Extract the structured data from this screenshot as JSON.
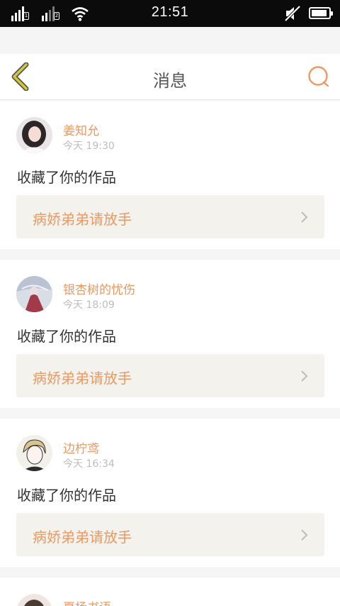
{
  "status": {
    "time": "21:51",
    "sim1": "1",
    "sim2": "2",
    "battery_level": 0.9
  },
  "nav": {
    "title": "消息",
    "back_icon": "chevron-left-icon",
    "chat_icon": "chat-bubble-icon"
  },
  "colors": {
    "accent": "#ee9862",
    "back": "#d4c63a",
    "card_inner": "#f3f2ec"
  },
  "feed": [
    {
      "user": "姜知允",
      "time": "今天 19:30",
      "action": "收藏了你的作品",
      "work": "病娇弟弟请放手"
    },
    {
      "user": "银杏树的忧伤",
      "time": "今天 18:09",
      "action": "收藏了你的作品",
      "work": "病娇弟弟请放手"
    },
    {
      "user": "边柠鸢",
      "time": "今天 16:34",
      "action": "收藏了你的作品",
      "work": "病娇弟弟请放手"
    },
    {
      "user": "夏杨书语"
    }
  ]
}
